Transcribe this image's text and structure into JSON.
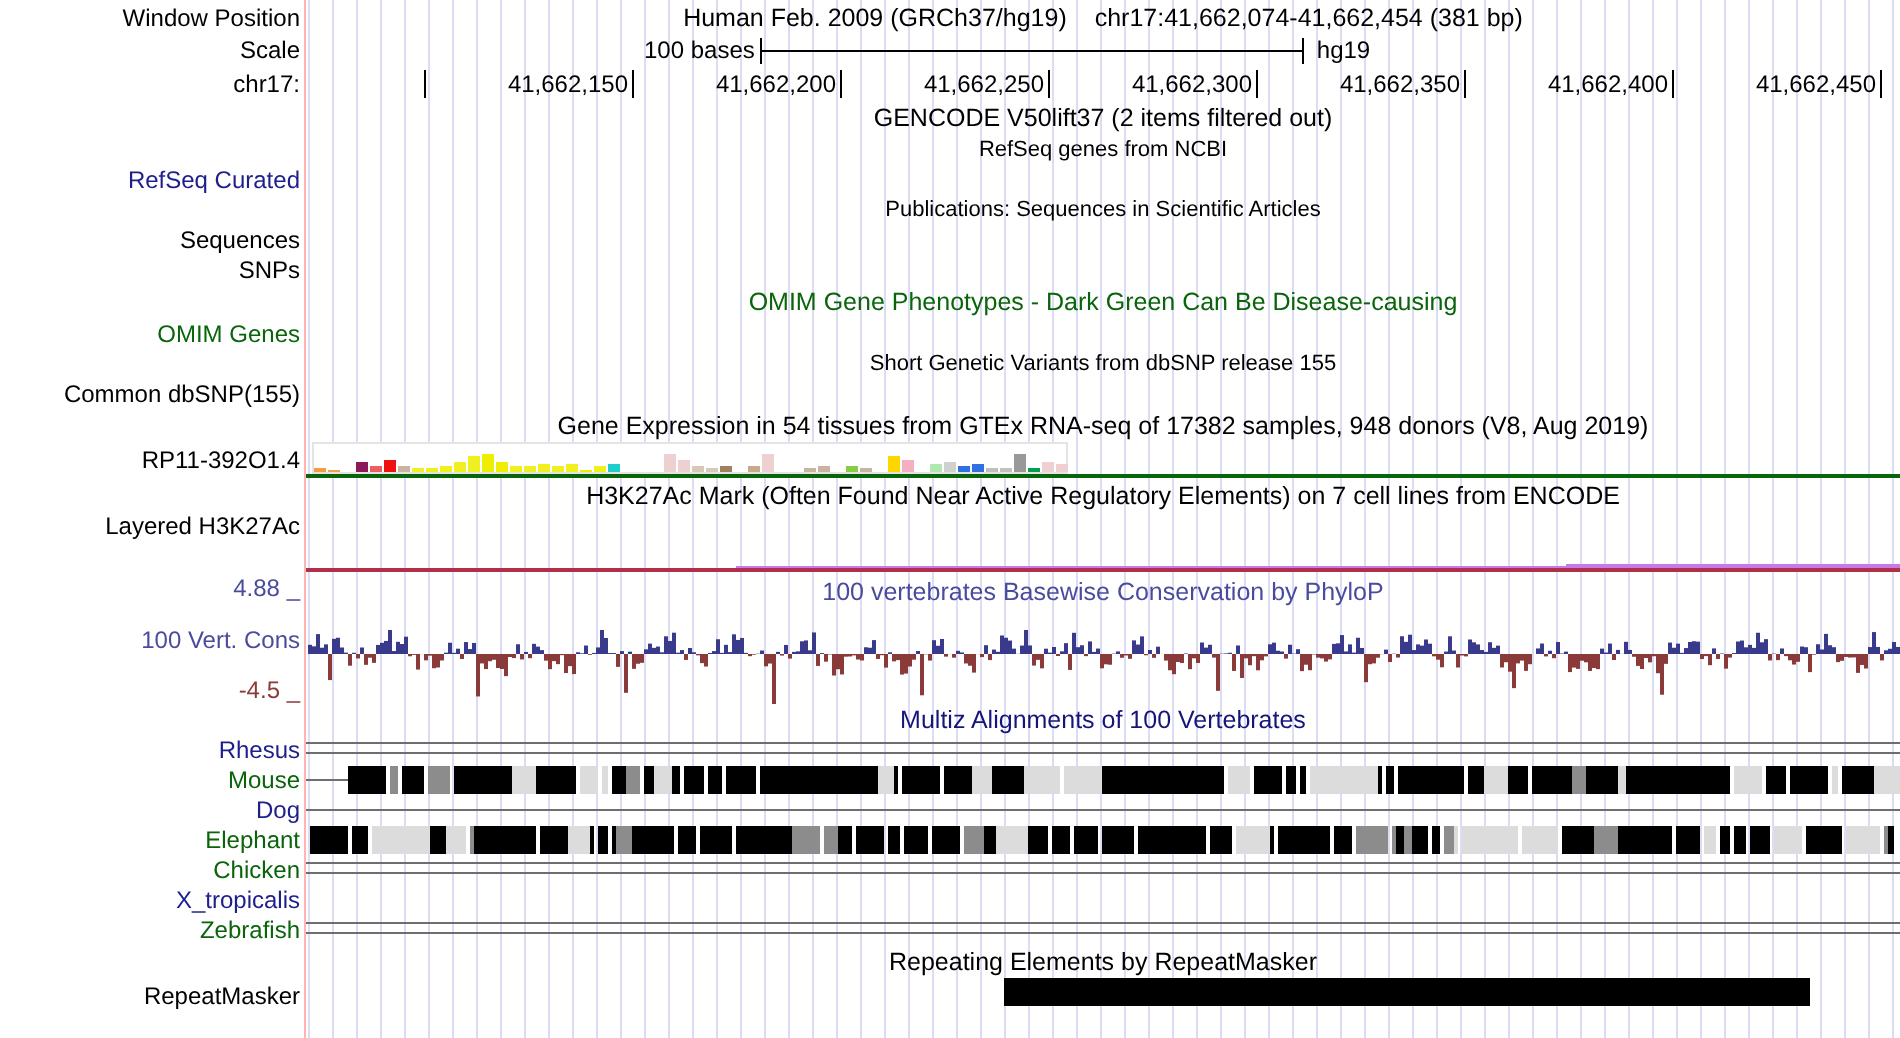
{
  "header": {
    "position_label": "Window Position",
    "assembly": "Human Feb. 2009 (GRCh37/hg19)",
    "coordinates": "chr17:41,662,074-41,662,454 (381 bp)",
    "scale_label": "Scale",
    "scale_text": "100 bases",
    "scale_assembly": "hg19",
    "chrom_label": "chr17:",
    "ruler_ticks": [
      "41,662,150",
      "41,662,200",
      "41,662,250",
      "41,662,300",
      "41,662,350",
      "41,662,400",
      "41,662,450"
    ]
  },
  "tracks": [
    {
      "kind": "empty",
      "title": {
        "text": "GENCODE V50lift37 (2 items filtered out)",
        "small": false
      }
    },
    {
      "kind": "empty",
      "title": {
        "text": "RefSeq genes from NCBI",
        "small": true
      },
      "label": {
        "text": "RefSeq Curated",
        "color": "#1e1e8c"
      }
    },
    {
      "kind": "empty",
      "title": {
        "text": "Publications: Sequences in Scientific Articles",
        "small": true
      },
      "label": {
        "text": "Sequences"
      }
    },
    {
      "kind": "empty",
      "label": {
        "text": "SNPs"
      }
    },
    {
      "kind": "empty",
      "title": {
        "text": "OMIM Gene Phenotypes - Dark Green Can Be Disease-causing",
        "small": false,
        "color": "#0a640a"
      },
      "label": {
        "text": "OMIM Genes",
        "color": "#0a640a"
      }
    },
    {
      "kind": "empty",
      "title": {
        "text": "Short Genetic Variants from dbSNP release 155",
        "small": true
      },
      "label": {
        "text": "Common dbSNP(155)"
      }
    },
    {
      "kind": "expression",
      "title": {
        "text": "Gene Expression in 54 tissues from GTEx RNA-seq of 17382 samples, 948 donors (V8, Aug 2019)",
        "small": false
      },
      "label": {
        "text": "RP11-392O1.4"
      }
    },
    {
      "kind": "layered",
      "title": {
        "text": "H3K27Ac Mark (Often Found Near Active Regulatory Elements) on 7 cell lines from ENCODE",
        "small": false
      },
      "label": {
        "text": "Layered H3K27Ac"
      }
    },
    {
      "kind": "wiggle",
      "title": {
        "text": "100 vertebrates Basewise Conservation by PhyloP",
        "small": false,
        "color": "#4b4b9e"
      },
      "label": {
        "text": "100 Vert. Cons",
        "color": "#4b4b9e"
      },
      "max_label": {
        "text": "4.88 _",
        "color": "#4b4b9e"
      },
      "min_label": {
        "text": "-4.5 _",
        "color": "#8b3a3a"
      }
    },
    {
      "kind": "multiz",
      "title": {
        "text": "Multiz Alignments of 100 Vertebrates",
        "small": false,
        "color": "#15157a"
      },
      "species": [
        {
          "name": "Rhesus",
          "color": "#1e1e8c",
          "kind": "double_line"
        },
        {
          "name": "Mouse",
          "color": "#0a640a",
          "kind": "blocks"
        },
        {
          "name": "Dog",
          "color": "#1e1e8c",
          "kind": "single_line"
        },
        {
          "name": "Elephant",
          "color": "#0a640a",
          "kind": "blocks"
        },
        {
          "name": "Chicken",
          "color": "#0a640a",
          "kind": "double_line"
        },
        {
          "name": "X_tropicalis",
          "color": "#1e1e8c",
          "kind": "none"
        },
        {
          "name": "Zebrafish",
          "color": "#0a640a",
          "kind": "double_line"
        }
      ]
    },
    {
      "kind": "repeat",
      "title": {
        "text": "Repeating Elements by RepeatMasker",
        "small": false
      },
      "label": {
        "text": "RepeatMasker"
      }
    }
  ]
}
